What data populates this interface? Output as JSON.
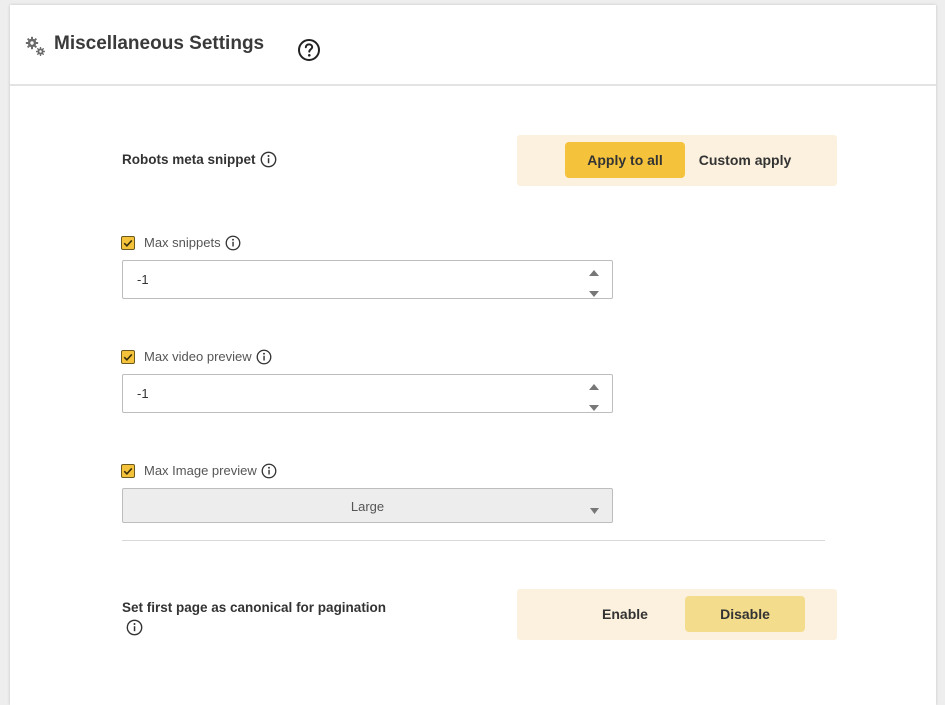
{
  "header": {
    "title": "Miscellaneous Settings",
    "settings_icon": "gears-icon",
    "help_icon": "question-circle-icon"
  },
  "robots_meta": {
    "label": "Robots meta snippet",
    "info_icon": "info-circle-icon",
    "options": [
      "Apply to all",
      "Custom apply"
    ],
    "selected": "Apply to all"
  },
  "max_snippets": {
    "label": "Max snippets",
    "checked": true,
    "value": "-1"
  },
  "max_video_preview": {
    "label": "Max video preview",
    "checked": true,
    "value": "-1"
  },
  "max_image_preview": {
    "label": "Max Image preview",
    "checked": true,
    "selected": "Large"
  },
  "canonical_pagination": {
    "label": "Set first page as canonical for pagination",
    "info_icon": "info-circle-icon",
    "options": [
      "Enable",
      "Disable"
    ],
    "selected": "Disable"
  },
  "colors": {
    "accent": "#f4c33b",
    "accent_soft": "#f3dc8c",
    "segment_bg": "#fbf1de",
    "card_bg": "#ffffff",
    "page_bg": "#eeeeee"
  }
}
